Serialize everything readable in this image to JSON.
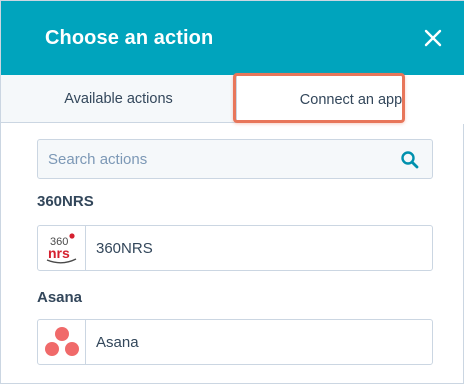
{
  "header": {
    "title": "Choose an action",
    "close_icon": "close-icon"
  },
  "tabs": [
    {
      "label": "Available actions",
      "selected": false
    },
    {
      "label": "Connect an app",
      "selected": true
    }
  ],
  "search": {
    "placeholder": "Search actions",
    "value": "",
    "icon": "search-icon"
  },
  "sections": [
    {
      "title": "360NRS",
      "app": {
        "name": "360NRS",
        "logo": "360nrs-logo",
        "logo_text_top": "360",
        "logo_text_bottom": "nrs"
      }
    },
    {
      "title": "Asana",
      "app": {
        "name": "Asana",
        "logo": "asana-logo"
      }
    }
  ],
  "colors": {
    "header_bg": "#00a4bd",
    "highlight": "#e8765a",
    "text": "#33475b",
    "placeholder": "#7c98b6",
    "border": "#cbd6e2",
    "search_icon": "#0091ae",
    "brand_360nrs": "#d5202f",
    "asana_coral": "#f06a6a"
  }
}
